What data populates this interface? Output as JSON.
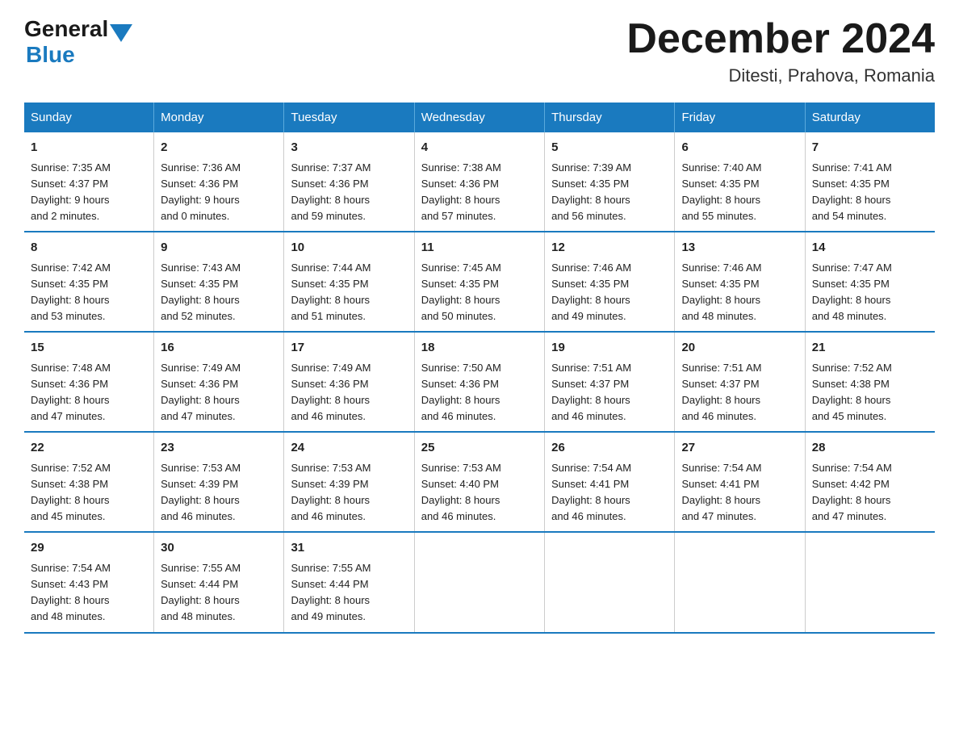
{
  "header": {
    "logo_general": "General",
    "logo_blue": "Blue",
    "title": "December 2024",
    "subtitle": "Ditesti, Prahova, Romania"
  },
  "days_of_week": [
    "Sunday",
    "Monday",
    "Tuesday",
    "Wednesday",
    "Thursday",
    "Friday",
    "Saturday"
  ],
  "weeks": [
    [
      {
        "day": "1",
        "sunrise": "7:35 AM",
        "sunset": "4:37 PM",
        "daylight": "9 hours and 2 minutes."
      },
      {
        "day": "2",
        "sunrise": "7:36 AM",
        "sunset": "4:36 PM",
        "daylight": "9 hours and 0 minutes."
      },
      {
        "day": "3",
        "sunrise": "7:37 AM",
        "sunset": "4:36 PM",
        "daylight": "8 hours and 59 minutes."
      },
      {
        "day": "4",
        "sunrise": "7:38 AM",
        "sunset": "4:36 PM",
        "daylight": "8 hours and 57 minutes."
      },
      {
        "day": "5",
        "sunrise": "7:39 AM",
        "sunset": "4:35 PM",
        "daylight": "8 hours and 56 minutes."
      },
      {
        "day": "6",
        "sunrise": "7:40 AM",
        "sunset": "4:35 PM",
        "daylight": "8 hours and 55 minutes."
      },
      {
        "day": "7",
        "sunrise": "7:41 AM",
        "sunset": "4:35 PM",
        "daylight": "8 hours and 54 minutes."
      }
    ],
    [
      {
        "day": "8",
        "sunrise": "7:42 AM",
        "sunset": "4:35 PM",
        "daylight": "8 hours and 53 minutes."
      },
      {
        "day": "9",
        "sunrise": "7:43 AM",
        "sunset": "4:35 PM",
        "daylight": "8 hours and 52 minutes."
      },
      {
        "day": "10",
        "sunrise": "7:44 AM",
        "sunset": "4:35 PM",
        "daylight": "8 hours and 51 minutes."
      },
      {
        "day": "11",
        "sunrise": "7:45 AM",
        "sunset": "4:35 PM",
        "daylight": "8 hours and 50 minutes."
      },
      {
        "day": "12",
        "sunrise": "7:46 AM",
        "sunset": "4:35 PM",
        "daylight": "8 hours and 49 minutes."
      },
      {
        "day": "13",
        "sunrise": "7:46 AM",
        "sunset": "4:35 PM",
        "daylight": "8 hours and 48 minutes."
      },
      {
        "day": "14",
        "sunrise": "7:47 AM",
        "sunset": "4:35 PM",
        "daylight": "8 hours and 48 minutes."
      }
    ],
    [
      {
        "day": "15",
        "sunrise": "7:48 AM",
        "sunset": "4:36 PM",
        "daylight": "8 hours and 47 minutes."
      },
      {
        "day": "16",
        "sunrise": "7:49 AM",
        "sunset": "4:36 PM",
        "daylight": "8 hours and 47 minutes."
      },
      {
        "day": "17",
        "sunrise": "7:49 AM",
        "sunset": "4:36 PM",
        "daylight": "8 hours and 46 minutes."
      },
      {
        "day": "18",
        "sunrise": "7:50 AM",
        "sunset": "4:36 PM",
        "daylight": "8 hours and 46 minutes."
      },
      {
        "day": "19",
        "sunrise": "7:51 AM",
        "sunset": "4:37 PM",
        "daylight": "8 hours and 46 minutes."
      },
      {
        "day": "20",
        "sunrise": "7:51 AM",
        "sunset": "4:37 PM",
        "daylight": "8 hours and 46 minutes."
      },
      {
        "day": "21",
        "sunrise": "7:52 AM",
        "sunset": "4:38 PM",
        "daylight": "8 hours and 45 minutes."
      }
    ],
    [
      {
        "day": "22",
        "sunrise": "7:52 AM",
        "sunset": "4:38 PM",
        "daylight": "8 hours and 45 minutes."
      },
      {
        "day": "23",
        "sunrise": "7:53 AM",
        "sunset": "4:39 PM",
        "daylight": "8 hours and 46 minutes."
      },
      {
        "day": "24",
        "sunrise": "7:53 AM",
        "sunset": "4:39 PM",
        "daylight": "8 hours and 46 minutes."
      },
      {
        "day": "25",
        "sunrise": "7:53 AM",
        "sunset": "4:40 PM",
        "daylight": "8 hours and 46 minutes."
      },
      {
        "day": "26",
        "sunrise": "7:54 AM",
        "sunset": "4:41 PM",
        "daylight": "8 hours and 46 minutes."
      },
      {
        "day": "27",
        "sunrise": "7:54 AM",
        "sunset": "4:41 PM",
        "daylight": "8 hours and 47 minutes."
      },
      {
        "day": "28",
        "sunrise": "7:54 AM",
        "sunset": "4:42 PM",
        "daylight": "8 hours and 47 minutes."
      }
    ],
    [
      {
        "day": "29",
        "sunrise": "7:54 AM",
        "sunset": "4:43 PM",
        "daylight": "8 hours and 48 minutes."
      },
      {
        "day": "30",
        "sunrise": "7:55 AM",
        "sunset": "4:44 PM",
        "daylight": "8 hours and 48 minutes."
      },
      {
        "day": "31",
        "sunrise": "7:55 AM",
        "sunset": "4:44 PM",
        "daylight": "8 hours and 49 minutes."
      },
      {
        "day": "",
        "sunrise": "",
        "sunset": "",
        "daylight": ""
      },
      {
        "day": "",
        "sunrise": "",
        "sunset": "",
        "daylight": ""
      },
      {
        "day": "",
        "sunrise": "",
        "sunset": "",
        "daylight": ""
      },
      {
        "day": "",
        "sunrise": "",
        "sunset": "",
        "daylight": ""
      }
    ]
  ],
  "labels": {
    "sunrise": "Sunrise:",
    "sunset": "Sunset:",
    "daylight": "Daylight:"
  }
}
